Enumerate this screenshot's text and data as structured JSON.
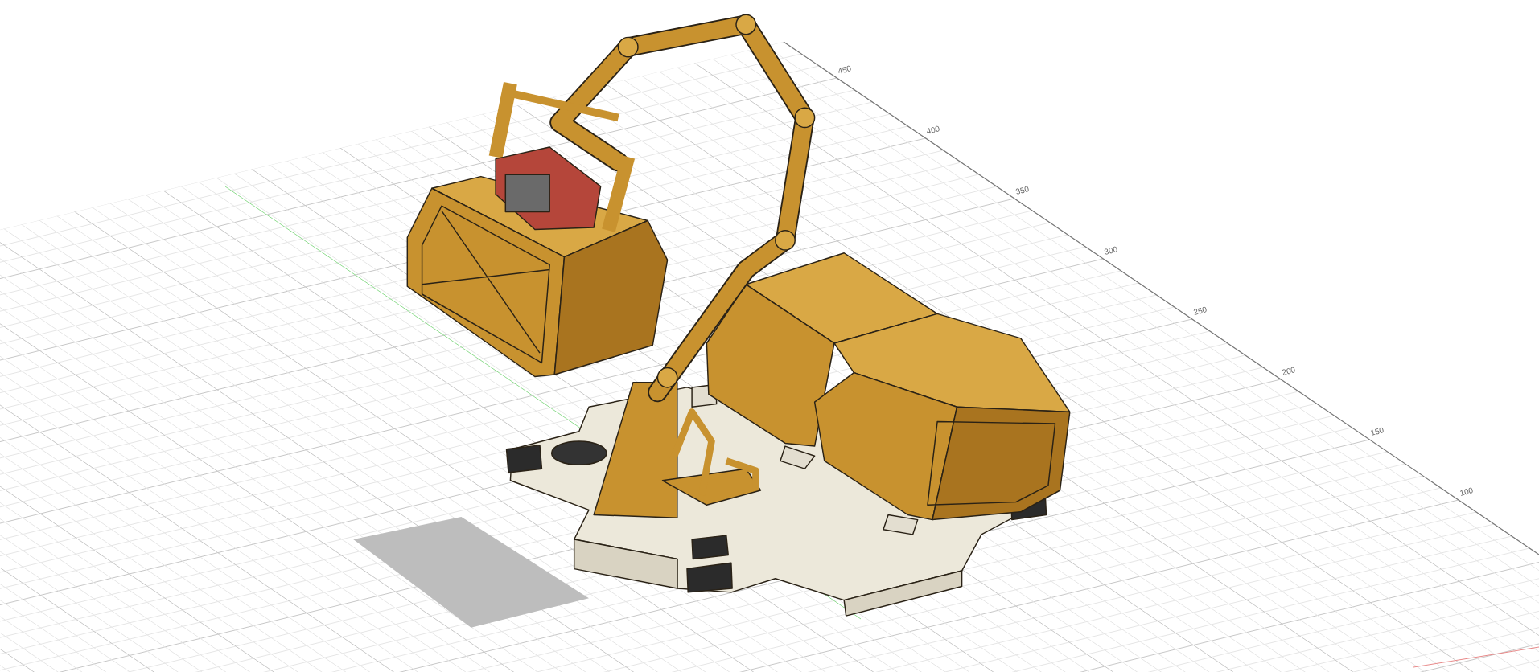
{
  "viewport": {
    "grid_labels": [
      "450",
      "400",
      "350",
      "300",
      "250",
      "200",
      "150",
      "100"
    ]
  }
}
